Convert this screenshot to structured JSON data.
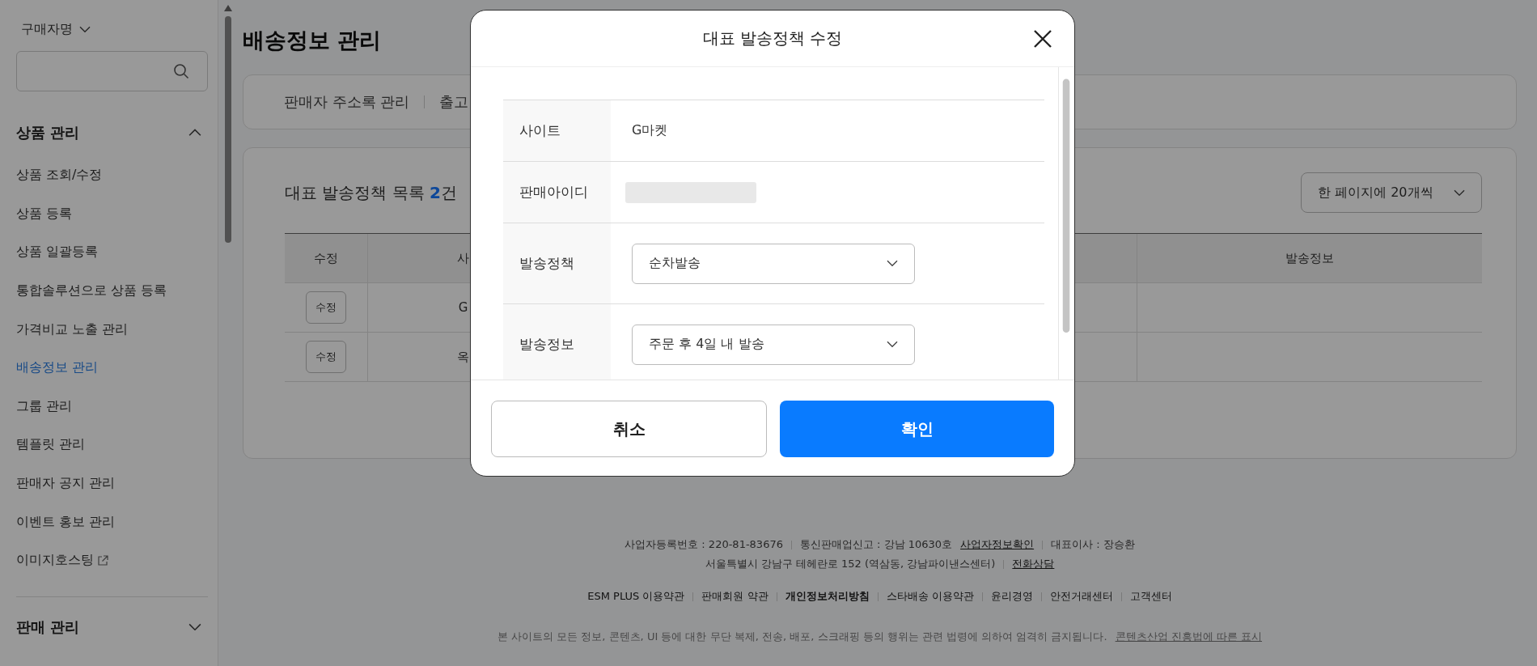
{
  "sidebar": {
    "buyer_dropdown": "구매자명",
    "sections": [
      {
        "title": "상품 관리",
        "expanded": true,
        "items": [
          {
            "label": "상품 조회/수정",
            "selected": false,
            "external": false
          },
          {
            "label": "상품 등록",
            "selected": false,
            "external": false
          },
          {
            "label": "상품 일괄등록",
            "selected": false,
            "external": false
          },
          {
            "label": "통합솔루션으로 상품 등록",
            "selected": false,
            "external": false
          },
          {
            "label": "가격비교 노출 관리",
            "selected": false,
            "external": false
          },
          {
            "label": "배송정보 관리",
            "selected": true,
            "external": false
          },
          {
            "label": "그룹 관리",
            "selected": false,
            "external": false
          },
          {
            "label": "템플릿 관리",
            "selected": false,
            "external": false
          },
          {
            "label": "판매자 공지 관리",
            "selected": false,
            "external": false
          },
          {
            "label": "이벤트 홍보 관리",
            "selected": false,
            "external": false
          },
          {
            "label": "이미지호스팅",
            "selected": false,
            "external": true
          }
        ]
      },
      {
        "title": "판매 관리",
        "expanded": false
      }
    ]
  },
  "page_title": "배송정보 관리",
  "tabs": [
    {
      "label": "판매자 주소록 관리"
    },
    {
      "label": "출고"
    }
  ],
  "list": {
    "title": "대표 발송정책 목록 **2**건",
    "page_size": "한 페이지에 20개씩",
    "columns": [
      "수정",
      "사",
      "발송정보"
    ],
    "rows": [
      {
        "edit": "수정",
        "site": "G"
      },
      {
        "edit": "수정",
        "site": "옥"
      }
    ]
  },
  "modal": {
    "title": "대표 발송정책 수정",
    "fields": [
      {
        "kind": "text",
        "label": "사이트",
        "value": "G마켓"
      },
      {
        "kind": "redacted",
        "label": "판매아이디"
      },
      {
        "kind": "select",
        "label": "발송정책",
        "value": "순차발송"
      },
      {
        "kind": "select",
        "label": "발송정보",
        "value": "주문 후 4일 내 발송"
      }
    ],
    "cancel": "취소",
    "confirm": "확인"
  },
  "footer": {
    "lines": [
      [
        {
          "text": "사업자등록번호 : 220-81-83676",
          "link": false
        },
        {
          "text": "통신판매업신고 : 강남 10630호",
          "link": false,
          "join": "사업자정보확인"
        },
        {
          "text": "대표이사 : 장승환",
          "link": false
        }
      ],
      [
        {
          "text": "서울특별시 강남구 테헤란로 152 (역삼동, 강남파이낸스센터)",
          "link": false
        },
        {
          "text": "전화상담",
          "link": true
        }
      ]
    ],
    "links": [
      {
        "text": "ESM PLUS 이용약관",
        "bold": false
      },
      {
        "text": "판매회원 약관",
        "bold": false
      },
      {
        "text": "개인정보처리방침",
        "bold": true
      },
      {
        "text": "스타배송 이용약관",
        "bold": false
      },
      {
        "text": "윤리경영",
        "bold": false
      },
      {
        "text": "안전거래센터",
        "bold": false
      },
      {
        "text": "고객센터",
        "bold": false
      }
    ],
    "notice": "본 사이트의 모든 정보, 콘텐츠, UI 등에 대한 무단 복제, 전송, 배포, 스크래핑 등의 행위는 관련 법령에 의하여 엄격히 금지됩니다.",
    "notice_link": "콘텐츠산업 진흥법에 따른 표시"
  }
}
